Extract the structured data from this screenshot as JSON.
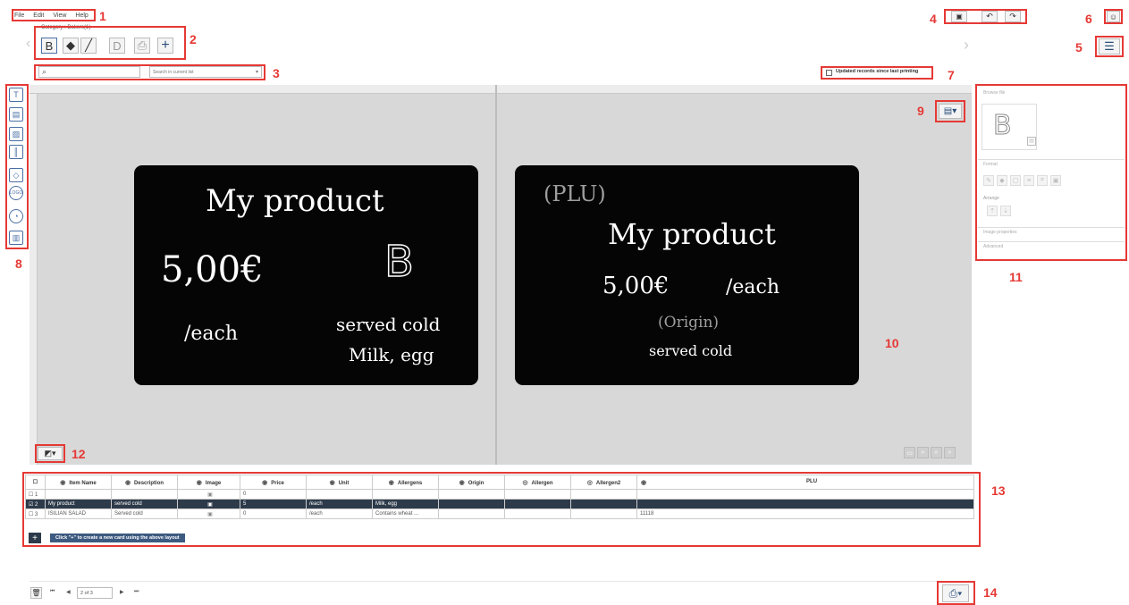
{
  "menu": [
    "File",
    "Edit",
    "View",
    "Help"
  ],
  "category_label": "Category : Bakers(1)",
  "search": {
    "placeholder": "",
    "scope": "Search in current list"
  },
  "updated_records_label": "Updated records since last printing",
  "callouts": [
    "1",
    "2",
    "3",
    "4",
    "5",
    "6",
    "7",
    "8",
    "9",
    "10",
    "11",
    "12",
    "13",
    "14"
  ],
  "card_left": {
    "name": "My product",
    "price": "5,00€",
    "unit": "/each",
    "badge": "B",
    "description": "served cold",
    "allergens": "Milk, egg"
  },
  "card_right": {
    "plu": "(PLU)",
    "name": "My product",
    "price": "5,00€",
    "unit": "/each",
    "origin": "(Origin)",
    "description": "served cold"
  },
  "right_panel": {
    "sections": [
      "Browse file",
      "Format",
      "Arrange",
      "Image properties",
      "Advanced"
    ],
    "badge": "B"
  },
  "table": {
    "columns": [
      "Item Name",
      "Description",
      "Image",
      "Price",
      "Unit",
      "Allergens",
      "Origin",
      "Allergen",
      "Allergen2",
      "PLU"
    ],
    "rows": [
      [
        "1",
        "",
        "",
        "",
        "0",
        "",
        "",
        "",
        "",
        "",
        ""
      ],
      [
        "2",
        "My product",
        "served cold",
        "",
        "5",
        "/each",
        "Milk, egg",
        "",
        "",
        "",
        ""
      ],
      [
        "3",
        "ISILIAN SALAD",
        "Served cold",
        "",
        "0",
        "/each",
        "Contains wheat ...",
        "",
        "",
        "",
        "11118"
      ]
    ],
    "add_hint": "Click \"+\" to create a new card using the above layout"
  },
  "pager": {
    "value": "2 of 3"
  },
  "colors": {
    "accent": "#e53935",
    "selected_row": "#2d3a4a",
    "canvas": "#d8d8d8"
  }
}
